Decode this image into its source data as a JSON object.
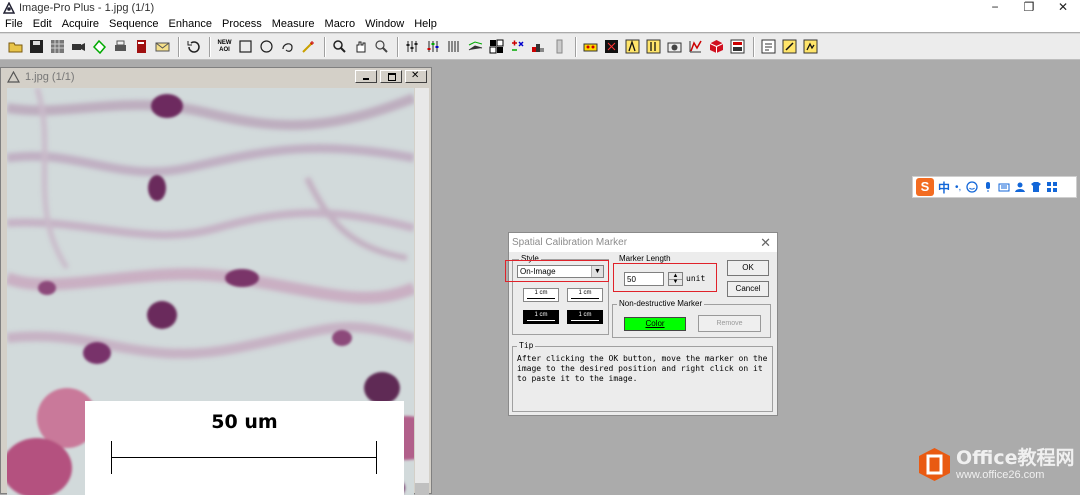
{
  "app": {
    "title": "Image-Pro Plus - 1.jpg (1/1)",
    "window_controls": {
      "minimize": "−",
      "maximize": "❐",
      "close": "✕"
    }
  },
  "menu": [
    "File",
    "Edit",
    "Acquire",
    "Sequence",
    "Enhance",
    "Process",
    "Measure",
    "Macro",
    "Window",
    "Help"
  ],
  "toolbar": {
    "new_aoi_label_top": "NEW",
    "new_aoi_label_bottom": "AOI",
    "icons": [
      "open-icon",
      "save-icon",
      "grid-icon",
      "camera-icon",
      "acquire-icon",
      "print-icon",
      "book-icon",
      "email-icon",
      "undo-icon",
      "new-aoi-icon",
      "rectangle-icon",
      "ellipse-icon",
      "irregular-icon",
      "wand-icon",
      "zoom-icon",
      "pan-icon",
      "zoom-fit-icon",
      "contrast-icon",
      "levels-icon",
      "histogram-icon",
      "filter-icon",
      "fourier-icon",
      "operations-icon",
      "bars-icon",
      "separator-icon",
      "count-icon",
      "classify-icon",
      "measure-icon",
      "calibrate-icon",
      "snapshot-icon",
      "graph-icon",
      "3d-icon",
      "report-icon",
      "script-icon",
      "macro-icon",
      "help-icon"
    ]
  },
  "image_window": {
    "title": "1.jpg (1/1)",
    "scale_label": "50 um"
  },
  "ime": {
    "logo": "S",
    "lang": "中",
    "punct": "•,"
  },
  "dialog": {
    "title": "Spatial Calibration Marker",
    "close": "✕",
    "style_group": "Style",
    "style_value": "On-Image",
    "style_sample": "1 cm",
    "marker_length_group": "Marker Length",
    "marker_length_value": "50",
    "unit": "unit",
    "ok": "OK",
    "cancel": "Cancel",
    "nondestructive_group": "Non-destructive Marker",
    "color_button": "Color",
    "remove_button": "Remove",
    "tip_group": "Tip",
    "tip_text": "After clicking the OK button, move the marker on the image to the desired position and right click on it to paste it to the image."
  },
  "watermark": {
    "line1": "Office教程网",
    "line2": "www.office26.com"
  },
  "colors": {
    "accent_red": "#e0222a",
    "color_button": "#00ff00",
    "desktop_bg": "#ababab"
  }
}
